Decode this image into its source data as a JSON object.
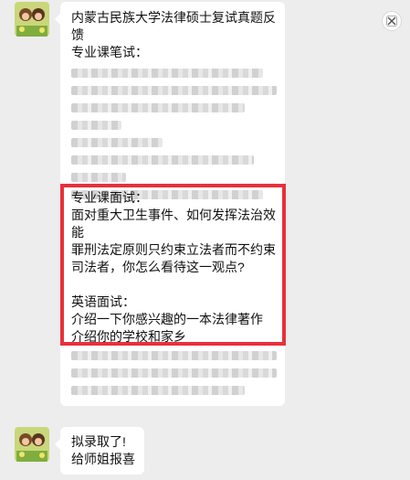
{
  "message1": {
    "lines": [
      "内蒙古民族大学法律硕士复试真题反",
      "馈",
      "专业课笔试："
    ],
    "interview_lines": [
      "专业课面试：",
      "面对重大卫生事件、如何发挥法治效",
      "能",
      "罪刑法定原则只约束立法者而不约束",
      "司法者，你怎么看待这一观点?",
      "",
      "英语面试：",
      "介绍一下你感兴趣的一本法律著作",
      "介绍你的学校和家乡"
    ]
  },
  "message2": {
    "lines": [
      "拟录取了!",
      "给师姐报喜"
    ]
  },
  "icons": {
    "avatar": "avatar-icon",
    "close": "close-icon"
  },
  "colors": {
    "background": "#ededed",
    "bubble": "#ffffff",
    "highlight": "#e8303a"
  }
}
